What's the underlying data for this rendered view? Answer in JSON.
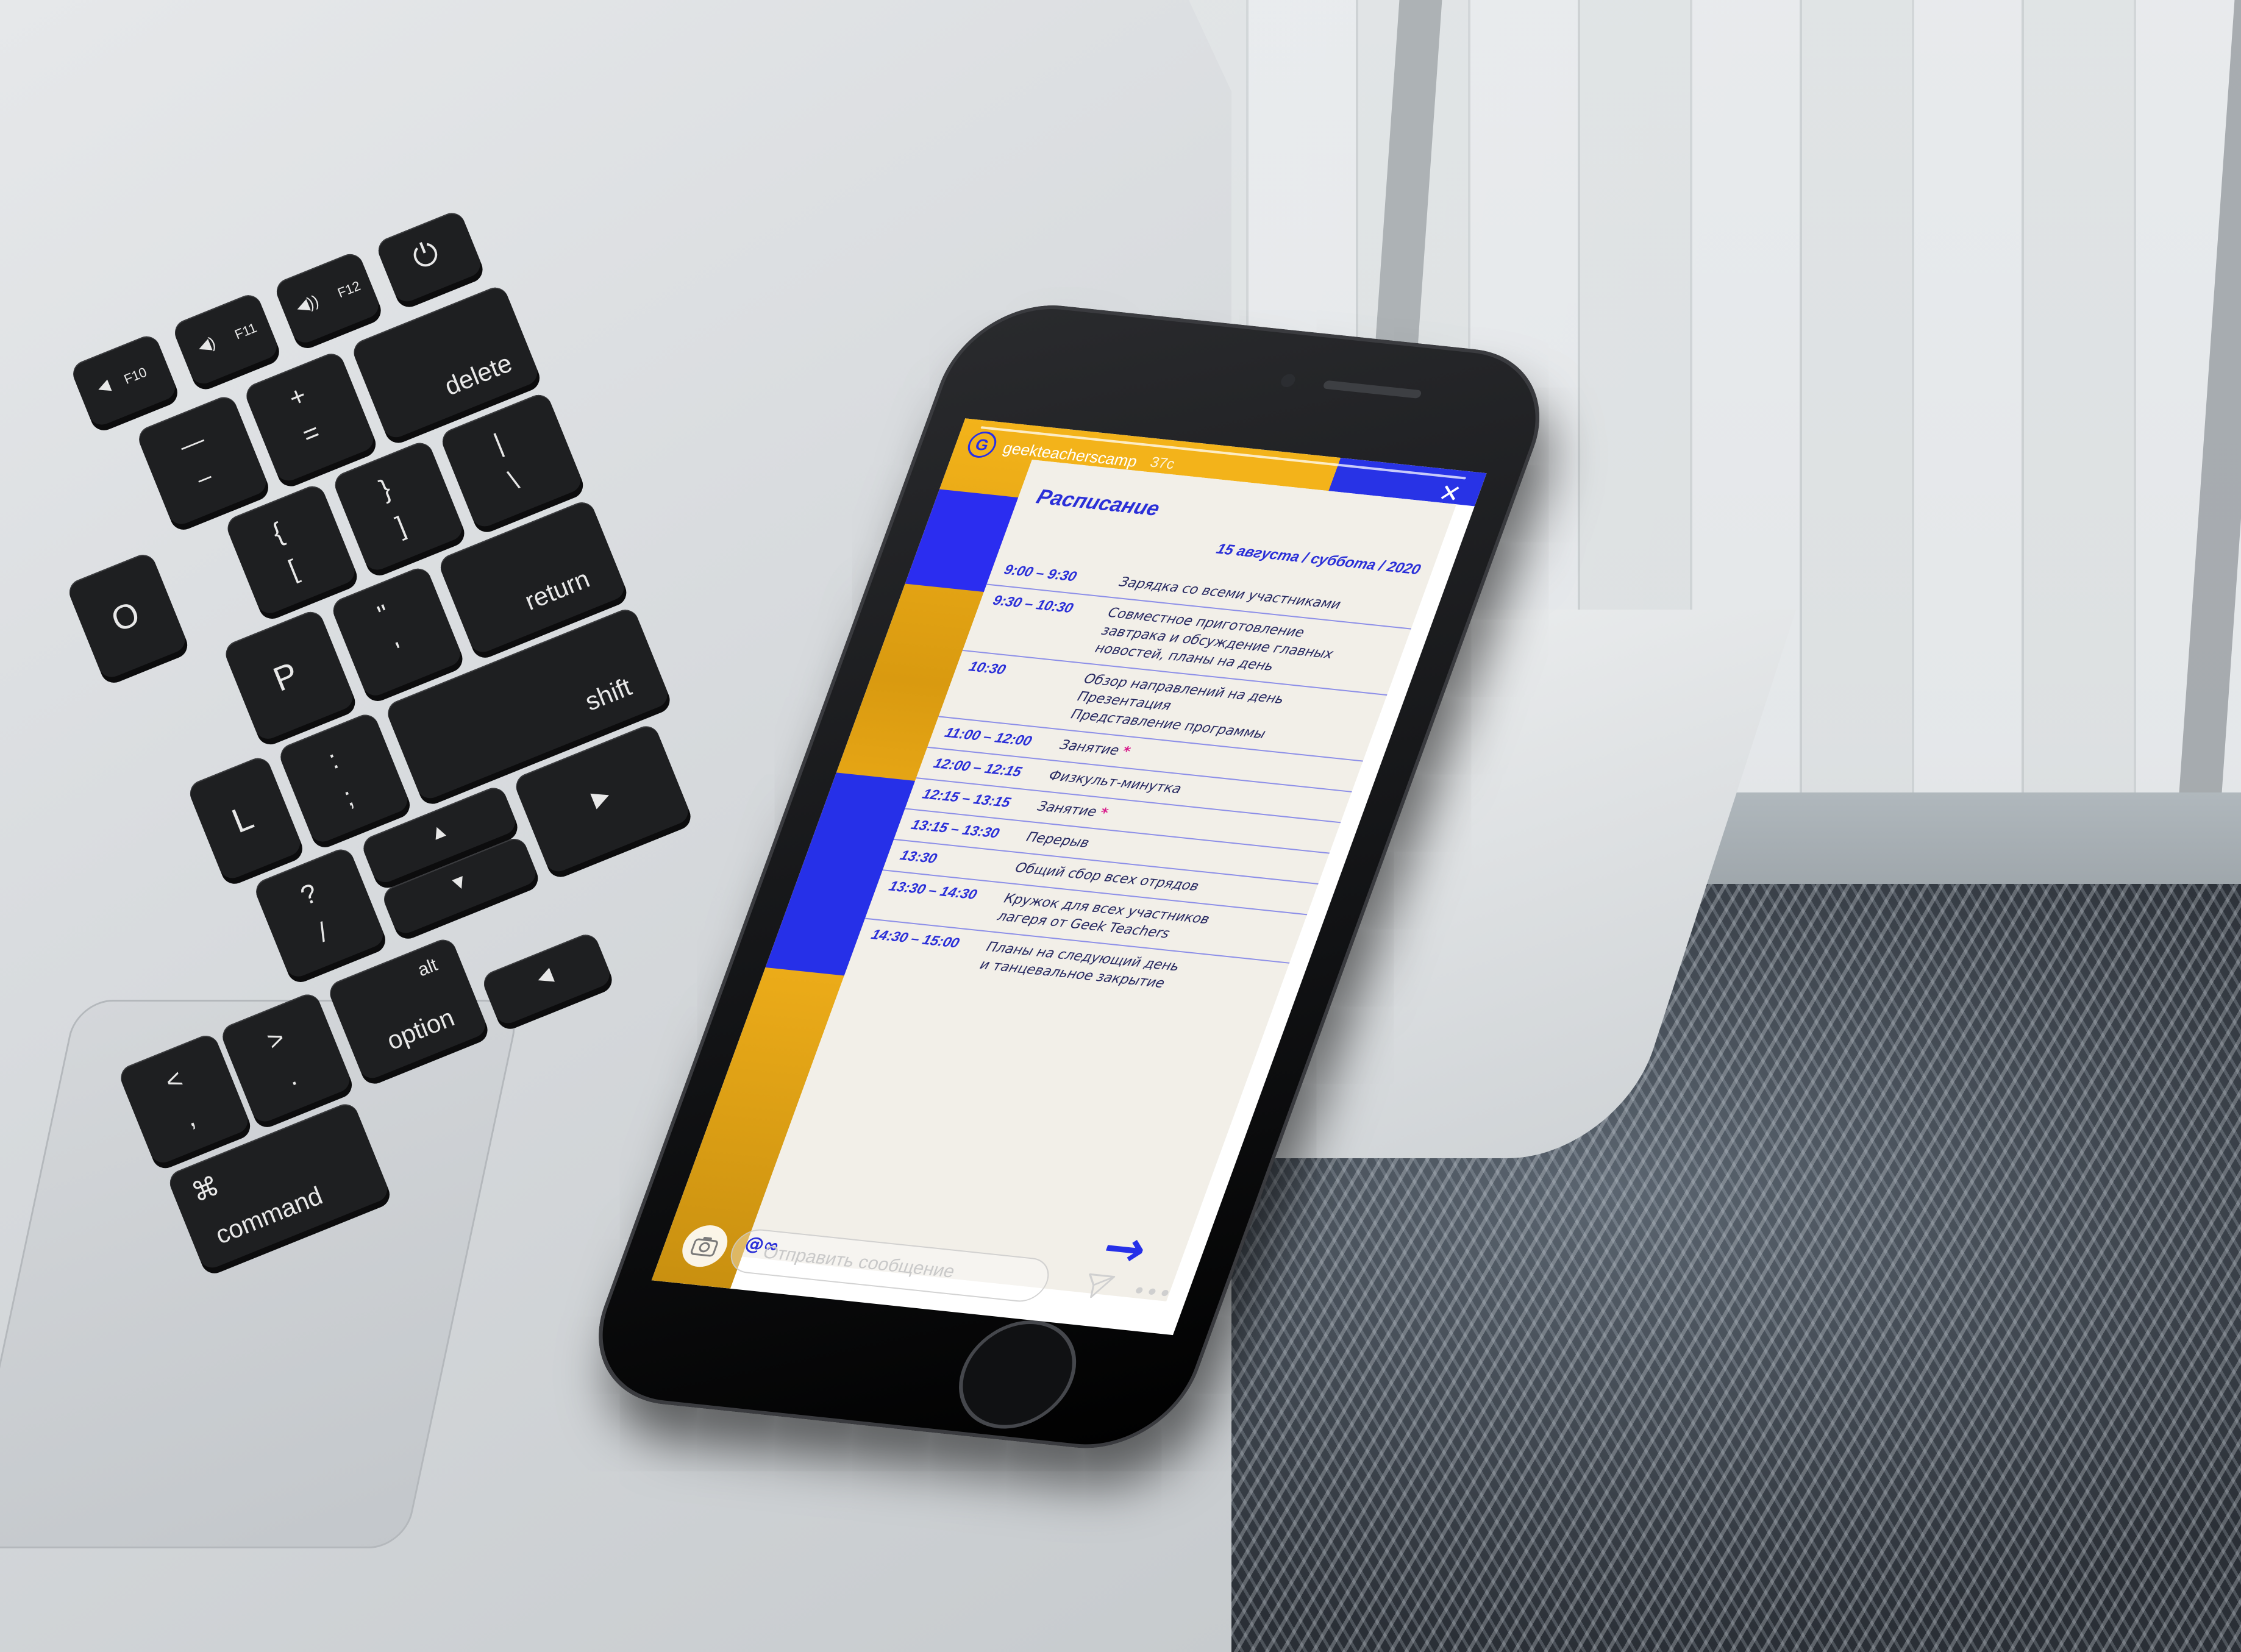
{
  "laptop": {
    "keys": {
      "power": "⏻",
      "f10": "F10",
      "f11": "F11",
      "f12": "F12",
      "delete": "delete",
      "return": "return",
      "shift": "shift",
      "option": "option",
      "alt": "alt",
      "command": "command",
      "cmd_symbol": "⌘",
      "p": "P",
      "l": "L",
      "o": "O",
      "minus_top": "—",
      "minus_bottom": "–",
      "plus_top": "+",
      "plus_bottom": "=",
      "brace_top": "{",
      "brace_bottom": "[",
      "rbrace_top": "}",
      "rbrace_bottom": "]",
      "pipe_top": "|",
      "pipe_bottom": "\\",
      "colon_top": ":",
      "colon_bottom": ";",
      "quote_top": "\"",
      "quote_bottom": "'",
      "question_top": "?",
      "question_bottom": "/",
      "gt_top": ">",
      "gt_bottom": ".",
      "lt_top": "<",
      "lt_bottom": ","
    }
  },
  "story": {
    "username": "geekteacherscamp",
    "time_ago": "37с",
    "avatar_letter": "G",
    "close_label": "✕"
  },
  "schedule": {
    "title": "Расписание",
    "date": "15 августа / суббота / 2020",
    "rows": [
      {
        "time": "9:00 – 9:30",
        "activity": "Зарядка со всеми участниками",
        "star": ""
      },
      {
        "time": "9:30 – 10:30",
        "activity": "Совместное приготовление\nзавтрака и обсуждение главных\nновостей, планы на день",
        "star": ""
      },
      {
        "time": "10:30",
        "activity": "Обзор направлений на день\nПрезентация\nПредставление программы",
        "star": ""
      },
      {
        "time": "11:00 – 12:00",
        "activity": "Занятие",
        "star": "*"
      },
      {
        "time": "12:00 – 12:15",
        "activity": "Физкульт-минутка",
        "star": ""
      },
      {
        "time": "12:15 – 13:15",
        "activity": "Занятие",
        "star": "*"
      },
      {
        "time": "13:15 – 13:30",
        "activity": "Перерыв",
        "star": ""
      },
      {
        "time": "13:30",
        "activity": "Общий сбор всех отрядов",
        "star": ""
      },
      {
        "time": "13:30 – 14:30",
        "activity": "Кружок для всех участников\nлагеря от Geek Teachers",
        "star": ""
      },
      {
        "time": "14:30 – 15:00",
        "activity": "Планы на следующий день\nи танцевальное закрытие",
        "star": ""
      }
    ]
  },
  "message_bar": {
    "placeholder": "Отправить сообщение",
    "mention": "@∞",
    "camera_icon": "camera-icon",
    "send_icon": "send-icon",
    "more_icon": "more-icon",
    "next_arrow": "→"
  },
  "colors": {
    "accent_blue": "#2a2fd8",
    "accent_yellow": "#f3b31a",
    "star_pink": "#d81b8a"
  }
}
